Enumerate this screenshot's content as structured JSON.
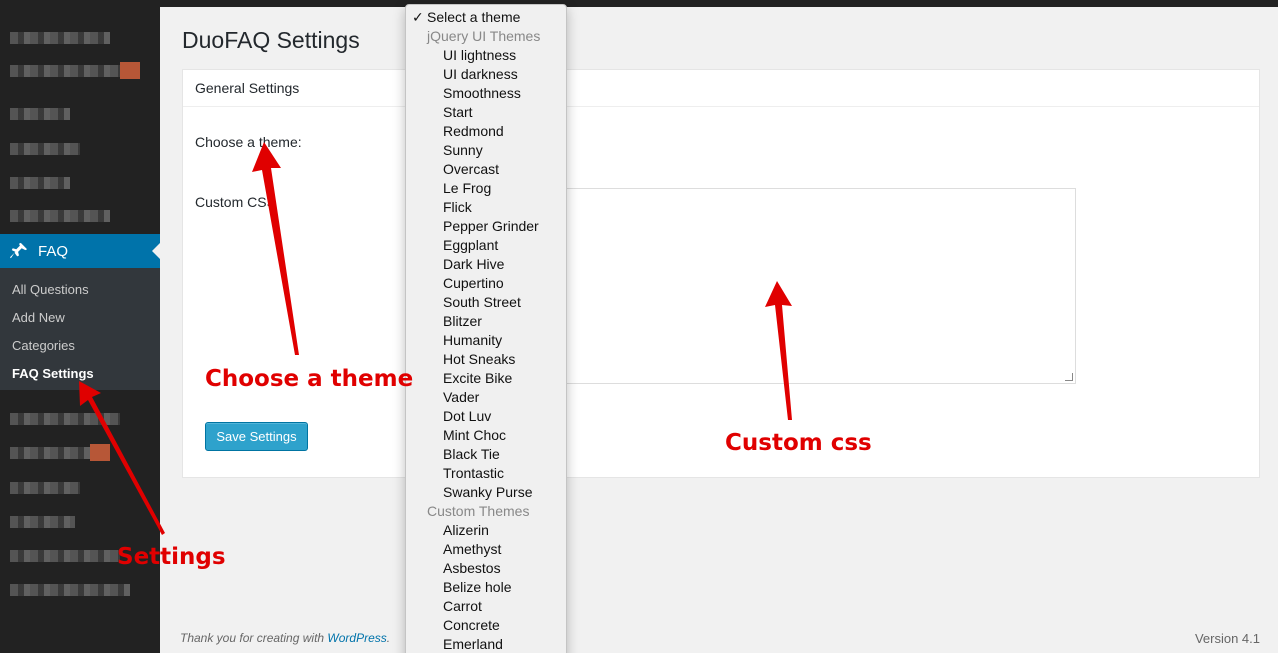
{
  "sidebar": {
    "menu_label": "FAQ",
    "submenu": [
      "All Questions",
      "Add New",
      "Categories",
      "FAQ Settings"
    ]
  },
  "page": {
    "title": "DuoFAQ Settings",
    "section_title": "General Settings",
    "theme_label": "Choose a theme:",
    "css_label": "Custom CSS",
    "save_label": "Save Settings"
  },
  "dropdown": {
    "selected": "Select a theme",
    "groups": [
      {
        "label": "jQuery UI Themes",
        "options": [
          "UI lightness",
          "UI darkness",
          "Smoothness",
          "Start",
          "Redmond",
          "Sunny",
          "Overcast",
          "Le Frog",
          "Flick",
          "Pepper Grinder",
          "Eggplant",
          "Dark Hive",
          "Cupertino",
          "South Street",
          "Blitzer",
          "Humanity",
          "Hot Sneaks",
          "Excite Bike",
          "Vader",
          "Dot Luv",
          "Mint Choc",
          "Black Tie",
          "Trontastic",
          "Swanky Purse"
        ]
      },
      {
        "label": "Custom Themes",
        "options": [
          "Alizerin",
          "Amethyst",
          "Asbestos",
          "Belize hole",
          "Carrot",
          "Concrete",
          "Emerland"
        ]
      }
    ]
  },
  "footer": {
    "thanks_text": "Thank you for creating with ",
    "link_text": "WordPress",
    "version": "Version 4.1"
  },
  "annotations": {
    "theme": "Choose a theme",
    "css": "Custom css",
    "settings": "Settings"
  },
  "colors": {
    "accent": "#0073aa",
    "annotation": "#e00000",
    "button": "#2ea2cc"
  }
}
